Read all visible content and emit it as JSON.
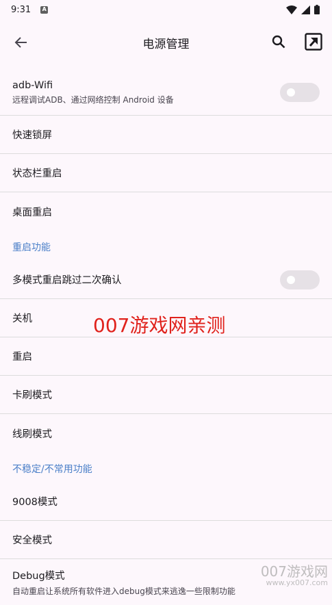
{
  "status_bar": {
    "time": "9:31",
    "badge": "A"
  },
  "app_bar": {
    "title": "电源管理"
  },
  "items": [
    {
      "title": "adb-Wifi",
      "subtitle": "远程调试ADB、通过网络控制 Android 设备",
      "toggle": false
    },
    {
      "title": "快速锁屏"
    },
    {
      "title": "状态栏重启"
    },
    {
      "title": "桌面重启"
    }
  ],
  "section_reboot": {
    "label": "重启功能"
  },
  "reboot_items": [
    {
      "title": "多模式重启跳过二次确认",
      "toggle": false
    },
    {
      "title": "关机"
    },
    {
      "title": "重启"
    },
    {
      "title": "卡刷模式"
    },
    {
      "title": "线刷模式"
    }
  ],
  "section_unstable": {
    "label": "不稳定/不常用功能"
  },
  "unstable_items": [
    {
      "title": "9008模式"
    },
    {
      "title": "安全模式"
    },
    {
      "title": "Debug模式",
      "subtitle": "自动重启让系统所有软件进入debug模式来逃逸一些限制功能"
    }
  ],
  "watermark": {
    "text": "007游戏网亲测",
    "corner_big": "007游戏网",
    "corner_small": "www.yx007.com"
  },
  "colors": {
    "background": "#fdf7fc",
    "accent": "#4a7fc8",
    "watermark": "#e0221c"
  }
}
